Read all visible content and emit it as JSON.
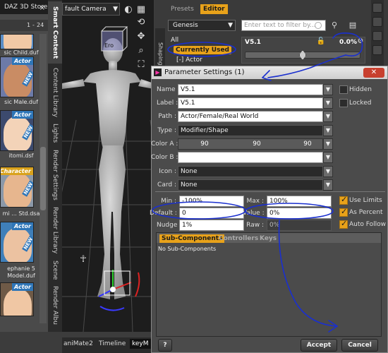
{
  "store": {
    "title": "DAZ 3D Store",
    "close": "×",
    "pager": {
      "start": "1",
      "separator": "-",
      "end": "24"
    },
    "items": [
      {
        "tag": "Actor",
        "new": "NEW",
        "file": "sic Child.duf",
        "skin": "#f1c9a6",
        "bg": "#5a8ec7"
      },
      {
        "tag": "Actor",
        "new": "NEW",
        "file": "sic Male.duf",
        "skin": "#c98c64",
        "bg": "#6c7aa8"
      },
      {
        "tag": "Actor",
        "new": "NEW",
        "file": "itomi.dsf",
        "skin": "#f3d3b8",
        "bg": "#3c4a6e"
      },
      {
        "tag": "Character",
        "new": "NEW",
        "file": "mi ... Std.dsa",
        "skin": "#e7b68e",
        "bg": "#8b98a8"
      },
      {
        "tag": "Actor",
        "new": "NEW",
        "file": "ephanie 5",
        "file2": "Model.duf",
        "skin": "#ecc2a1",
        "bg": "#3f7fb9"
      },
      {
        "tag": "Actor",
        "new": "",
        "file": "",
        "skin": "#f0c7a4",
        "bg": "#6f5a47"
      }
    ]
  },
  "paneTabs": [
    "Smart Content",
    "Content Library",
    "Lights",
    "Render Settings",
    "Render Library",
    "Scene",
    "Render Albu"
  ],
  "viewport": {
    "camera": "fault Camera",
    "dropdown": "▼",
    "gizmo_label": "Ero"
  },
  "bottomTabs": [
    "aniMate2",
    "Timeline",
    "keyM"
  ],
  "params": {
    "tabs": [
      "Presets",
      "Editor"
    ],
    "shaping": "Shaping",
    "figure": "Genesis",
    "dropdown": "▼",
    "tree": [
      "All",
      "Currently Used",
      "Actor"
    ],
    "tree_expand": "[-]",
    "filter_placeholder": "Enter text to filter by...",
    "slider": {
      "label": "V5.1",
      "value_text": "0.0%",
      "value": 0.0,
      "min": -100,
      "max": 100
    }
  },
  "dialog": {
    "title": "Parameter Settings (1)",
    "close": "✕",
    "fields": {
      "name": {
        "label": "Name :",
        "value": "V5.1"
      },
      "labelf": {
        "label": "Label :",
        "value": "V5.1"
      },
      "path": {
        "label": "Path :",
        "value": "Actor/Female/Real World"
      },
      "type": {
        "label": "Type :",
        "value": "Modifier/Shape"
      },
      "colorA": {
        "label": "Color A :",
        "r": "90",
        "g": "90",
        "b": "90"
      },
      "colorB": {
        "label": "Color B :",
        "r": "255",
        "g": "255",
        "b": "255"
      },
      "icon": {
        "label": "Icon :",
        "value": "None"
      },
      "card": {
        "label": "Card :",
        "value": "None"
      },
      "min": {
        "label": "Min :",
        "value": "-100%"
      },
      "max": {
        "label": "Max :",
        "value": "100%"
      },
      "def": {
        "label": "Default :",
        "value": "0"
      },
      "value": {
        "label": "Value :",
        "value": "0%"
      },
      "nudge": {
        "label": "Nudge :",
        "value": "1%"
      },
      "raw": {
        "label": "Raw :",
        "value": "0%"
      }
    },
    "checks": {
      "hidden": {
        "label": "Hidden",
        "on": false
      },
      "locked": {
        "label": "Locked",
        "on": false
      },
      "useLimits": {
        "label": "Use Limits",
        "on": true
      },
      "asPercent": {
        "label": "As Percent",
        "on": true
      },
      "autoFollow": {
        "label": "Auto Follow",
        "on": true
      }
    },
    "subTabs": [
      "Sub-Components",
      "Controllers",
      "Keys"
    ],
    "noSub": "No Sub-Components",
    "help": "?",
    "accept": "Accept",
    "cancel": "Cancel"
  },
  "colors": {
    "accent": "#e8a21a",
    "annotation": "#1a2fcf",
    "close_red": "#c8402f"
  }
}
